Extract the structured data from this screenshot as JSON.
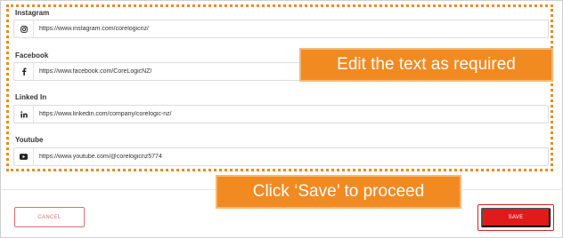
{
  "fields": [
    {
      "label": "Instagram",
      "icon": "instagram-icon",
      "value": "https://www.instagram.com/corelogicnz/"
    },
    {
      "label": "Facebook",
      "icon": "facebook-icon",
      "value": "https://www.facebook.com/CoreLogicNZ/"
    },
    {
      "label": "Linked In",
      "icon": "linkedin-icon",
      "value": "https://www.linkedin.com/company/corelogic-nz/"
    },
    {
      "label": "Youtube",
      "icon": "youtube-icon",
      "value": "https://www.youtube.com/@corelogicnz5774"
    }
  ],
  "callouts": {
    "edit": "Edit the text as required",
    "save": "Click ‘Save’ to proceed"
  },
  "actions": {
    "cancel_label": "CANCEL",
    "save_label": "SAVE"
  },
  "colors": {
    "annotation_orange": "#f28a22",
    "save_red": "#e11a1a",
    "cancel_red": "#e06d6d"
  }
}
